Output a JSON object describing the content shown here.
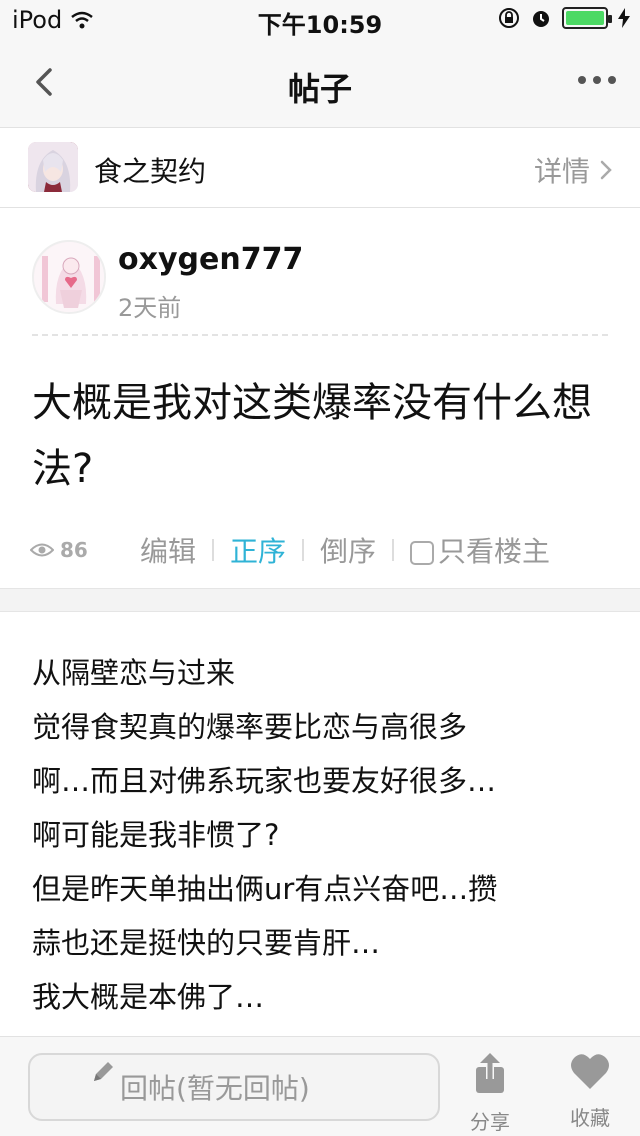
{
  "status_bar": {
    "carrier": "iPod",
    "time": "下午10:59"
  },
  "nav": {
    "title": "帖子"
  },
  "forum": {
    "name": "食之契约",
    "detail_label": "详情"
  },
  "post": {
    "author": "oxygen777",
    "time": "2天前",
    "title": "大概是我对这类爆率没有什么想法?",
    "views": "86",
    "toolbar": {
      "edit": "编辑",
      "order_asc": "正序",
      "order_desc": "倒序",
      "only_op": "只看楼主"
    }
  },
  "reply": {
    "lines": [
      "从隔壁恋与过来",
      "觉得食契真的爆率要比恋与高很多",
      "啊…而且对佛系玩家也要友好很多…",
      "啊可能是我非惯了?",
      "但是昨天单抽出俩ur有点兴奋吧…攒",
      "蒜也还是挺快的只要肯肝…",
      "我大概是本佛了…"
    ]
  },
  "bottom_bar": {
    "reply_placeholder": "回帖(暂无回帖)",
    "share_label": "分享",
    "favorite_label": "收藏"
  },
  "colors": {
    "accent": "#2fb3d6",
    "battery": "#4cd964"
  }
}
